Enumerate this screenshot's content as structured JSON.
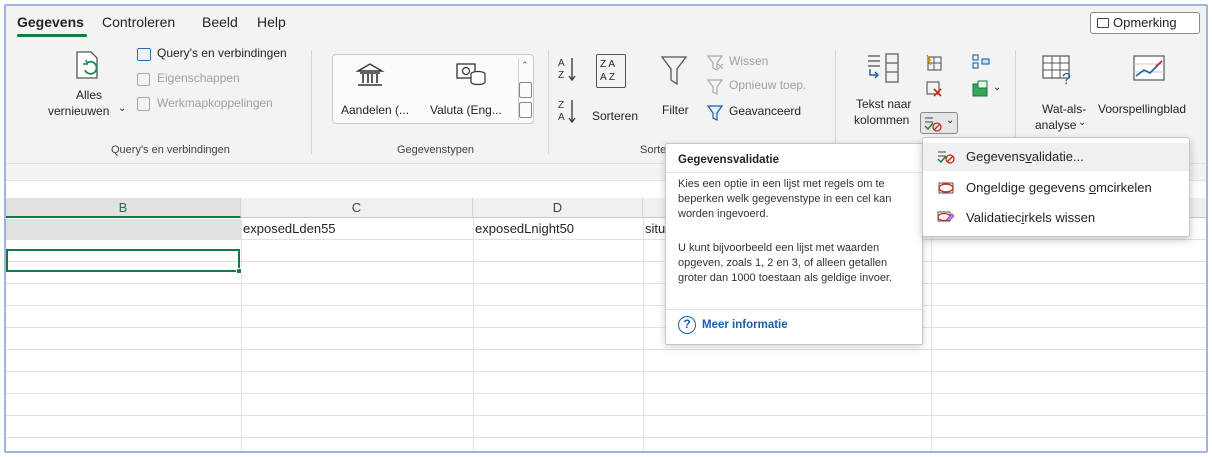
{
  "tabs": [
    {
      "label": "Gegevens",
      "active": true
    },
    {
      "label": "Controleren"
    },
    {
      "label": "Beeld"
    },
    {
      "label": "Help"
    }
  ],
  "comment_button": "Opmerking",
  "ribbon": {
    "refresh_all_line1": "Alles",
    "refresh_all_line2": "vernieuwen",
    "queries_connections": "Query's en verbindingen",
    "properties": "Eigenschappen",
    "workbook_links": "Werkmapkoppelingen",
    "group_queries": "Query's en verbindingen",
    "stocks": "Aandelen (...",
    "currencies": "Valuta (Eng...",
    "group_datatypes": "Gegevenstypen",
    "sort": "Sorteren",
    "filter": "Filter",
    "clear": "Wissen",
    "reapply": "Opnieuw toep.",
    "advanced": "Geavanceerd",
    "group_sort": "Sorte",
    "text_to_columns_line1": "Tekst naar",
    "text_to_columns_line2": "kolommen",
    "whatif_line1": "Wat-als-",
    "whatif_line2": "analyse",
    "forecast": "Voorspellingblad"
  },
  "sheet": {
    "columns": [
      "B",
      "C",
      "D"
    ],
    "row1": {
      "c": "exposedLden55",
      "d": "exposedLnight50",
      "e_partial": "situ",
      "right_partial": "situationOfImprovementPrioritisationCri"
    }
  },
  "tooltip": {
    "title": "Gegevensvalidatie",
    "para1": "Kies een optie in een lijst met regels om te beperken welk gegevenstype in een cel kan worden ingevoerd.",
    "para2": "U kunt bijvoorbeeld een lijst met waarden opgeven, zoals 1, 2 en 3, of alleen getallen groter dan 1000 toestaan als geldige invoer.",
    "more": "Meer informatie"
  },
  "menu": {
    "items": [
      {
        "pre": "Gegevens",
        "u": "v",
        "post": "alidatie...",
        "icon": "data-validation-icon"
      },
      {
        "pre": "Ongeldige gegevens ",
        "u": "o",
        "post": "mcirkelen",
        "icon": "circle-invalid-icon"
      },
      {
        "pre": "Validatiec",
        "u": "i",
        "post": "rkels wissen",
        "icon": "clear-circles-icon"
      }
    ]
  },
  "colors": {
    "accent": "#107c41",
    "link": "#1b5ea8",
    "frame": "#9fb5dc"
  }
}
